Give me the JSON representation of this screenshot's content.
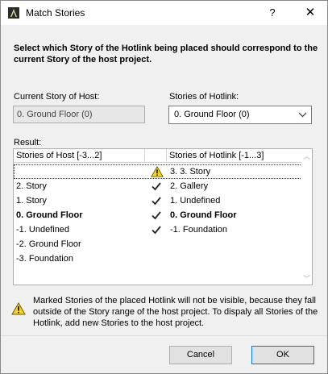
{
  "window": {
    "title": "Match Stories",
    "help_label": "?",
    "close_label": "✕"
  },
  "instructions": "Select which Story of the Hotlink being placed should correspond to the current Story of the host project.",
  "host": {
    "label": "Current Story of Host:",
    "value": "0. Ground Floor (0)"
  },
  "hotlink": {
    "label": "Stories of Hotlink:",
    "selected": "0. Ground Floor (0)"
  },
  "result": {
    "label": "Result:",
    "headers": {
      "host": "Stories of Host [-3...2]",
      "hotlink": "Stories of Hotlink [-1...3]"
    },
    "rows": [
      {
        "host": "",
        "mark": "warning",
        "hotlink": "3. 3. Story",
        "bold": false
      },
      {
        "host": "2. Story",
        "mark": "check",
        "hotlink": "2. Gallery",
        "bold": false
      },
      {
        "host": "1. Story",
        "mark": "check",
        "hotlink": "1. Undefined",
        "bold": false
      },
      {
        "host": "0. Ground Floor",
        "mark": "check",
        "hotlink": "0. Ground Floor",
        "bold": true
      },
      {
        "host": "-1. Undefined",
        "mark": "check",
        "hotlink": "-1. Foundation",
        "bold": false
      },
      {
        "host": "-2. Ground Floor",
        "mark": "",
        "hotlink": "",
        "bold": false
      },
      {
        "host": "-3. Foundation",
        "mark": "",
        "hotlink": "",
        "bold": false
      }
    ]
  },
  "note": "Marked Stories of the placed Hotlink will not be visible, because they fall outside of the Story range of the host project. To dispaly all Stories of the Hotlink, add new Stories to the host project.",
  "buttons": {
    "cancel": "Cancel",
    "ok": "OK"
  },
  "colors": {
    "warning_fill": "#f5d327",
    "accent_border": "#0078d7"
  },
  "icons": {
    "app": "archicad-icon",
    "warning": "warning-icon",
    "check": "check-icon",
    "dropdown": "chevron-down-icon"
  }
}
